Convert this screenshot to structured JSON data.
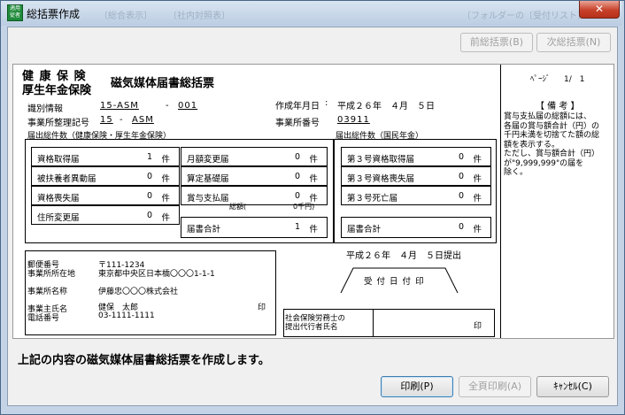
{
  "window": {
    "title": "総括票作成",
    "icon_text": "適用\n従者",
    "ghost_texts": [
      "〔総合表示〕",
      "〔社内対照表〕",
      "〔フォルダーの〔受付リスト〕"
    ],
    "close_label": "✕"
  },
  "nav": {
    "prev_label": "前総括票(B)",
    "next_label": "次総括票(N)"
  },
  "header": {
    "line1": "健 康 保 険",
    "line2": "厚生年金保険",
    "form_title": "磁気媒体届書総括票",
    "page_label": "ﾍﾟｰｼﾞ",
    "page_value": "1/　1"
  },
  "info": {
    "id_label": "識別情報",
    "id_value1": "15-ASM",
    "id_sep": "-",
    "id_value2": "001",
    "date_label": "作成年月日",
    "date_colon": ":",
    "date_value": "平成２６年　４月　５日",
    "office_code_label": "事業所整理記号",
    "office_code_value1": "15",
    "office_code_sep": "-",
    "office_code_value2": "ASM",
    "office_number_label": "事業所番号",
    "office_number_value": "03911"
  },
  "health": {
    "section_label": "届出総件数（健康保険・厚生年金保険）",
    "unit": "件",
    "col1": [
      {
        "label": "資格取得届",
        "value": "1"
      },
      {
        "label": "被扶養者異動届",
        "value": "0"
      },
      {
        "label": "資格喪失届",
        "value": "0"
      },
      {
        "label": "住所変更届",
        "value": "0"
      }
    ],
    "col2": [
      {
        "label": "月額変更届",
        "value": "0"
      },
      {
        "label": "算定基礎届",
        "value": "0"
      },
      {
        "label": "賞与支払届",
        "value": "0"
      }
    ],
    "bonus_sub_label": "総額(",
    "bonus_sub_value": "0千円)",
    "total_label": "届書合計",
    "total_value": "1"
  },
  "pension": {
    "section_label": "届出総件数（国民年金）",
    "unit": "件",
    "rows": [
      {
        "label": "第３号資格取得届",
        "value": "0"
      },
      {
        "label": "第３号資格喪失届",
        "value": "0"
      },
      {
        "label": "第３号死亡届",
        "value": "0"
      }
    ],
    "total_label": "届書合計",
    "total_value": "0"
  },
  "remarks": {
    "title": "【 備 考 】",
    "lines": [
      "賞与支払届の総額には、",
      "各届の賞与額合計（円）の",
      "千円未満を切捨てた額の総",
      "額を表示する。",
      "ただし、賞与額合計（円）",
      "が\"9,999,999\"の届を",
      "除く。"
    ]
  },
  "address": {
    "postal_label": "郵便番号",
    "postal_value": "〒111-1234",
    "location_label": "事業所所在地",
    "location_value": "東京都中央区日本橋〇〇〇1-1-1",
    "name_label": "事業所名称",
    "name_value": "伊藤忠〇〇〇株式会社",
    "owner_label": "事業主氏名",
    "owner_value": "健保　太郎",
    "seal": "印",
    "phone_label": "電話番号",
    "phone_value": "03-1111-1111"
  },
  "submit_date": "平成２６年　４月　５日提出",
  "receipt_label": "受 付 日 付 印",
  "agent": {
    "label_line1": "社会保険労務士の",
    "label_line2": "提出代行者氏名",
    "seal": "印"
  },
  "message": "上記の内容の磁気媒体届書総括票を作成します。",
  "buttons": {
    "print": "印刷(P)",
    "print_all": "全頁印刷(A)",
    "cancel": "ｷｬﾝｾﾙ(C)"
  }
}
